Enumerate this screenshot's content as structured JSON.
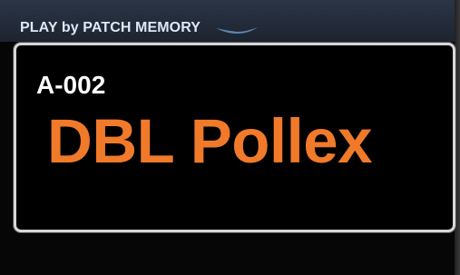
{
  "header": {
    "mode_label": "PLAY by PATCH MEMORY"
  },
  "patch": {
    "number": "A-002",
    "name": "DBL Pollex"
  },
  "colors": {
    "header_bg": "#262f3e",
    "header_text": "#dce8f4",
    "swoosh": "#5f86aa",
    "panel_border": "#d7d7d7",
    "patch_number": "#ffffff",
    "patch_name": "#f07a2a",
    "background": "#060606"
  },
  "icons": {
    "mode_indicator": "swoosh-icon"
  }
}
